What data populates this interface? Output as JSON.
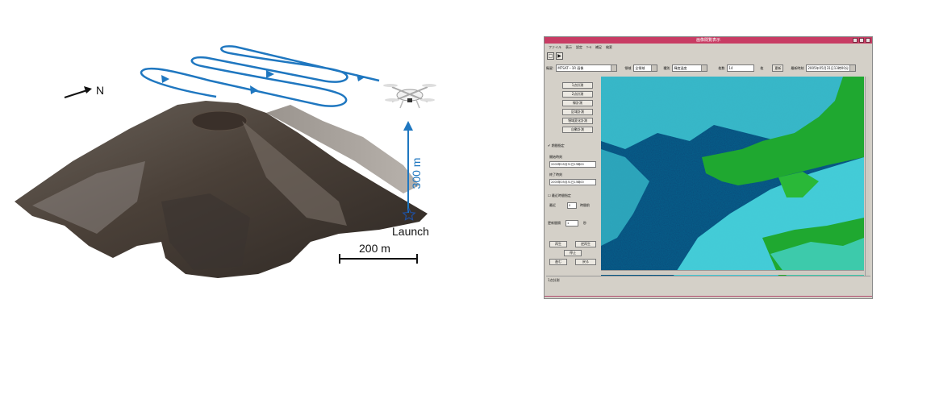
{
  "left_figure": {
    "north_label": "N",
    "altitude_label": "300 m",
    "launch_label": "Launch",
    "scale_label": "200 m",
    "colors": {
      "flight_path": "#1f77c0",
      "terrain_dark": "#4a4038",
      "terrain_light": "#9a948e"
    },
    "icons": [
      "north-arrow-icon",
      "drone-icon",
      "launch-star-icon"
    ]
  },
  "app": {
    "title": "画像閲覧表示",
    "menu": [
      "ファイル",
      "表示",
      "設定",
      "ﾂｰﾙ",
      "補足",
      "検索"
    ],
    "toolbar": [
      "□",
      "▶"
    ],
    "params": {
      "source_label": "衛星:",
      "source_value": "MTSAT－1R 画像",
      "region_label": "領域",
      "region_value": "全領域",
      "type_label": "種別",
      "type_value": "輝度温度",
      "count_label": "枚数",
      "count_value": "14",
      "unit": "枚",
      "update_button": "更新",
      "latest_label": "最新時刻",
      "latest_value": "2005年05月31日13時00分"
    },
    "side_buttons": [
      "1点計測",
      "2点計測",
      "線計測",
      "区域計測",
      "領域変化計測",
      "自動計測"
    ],
    "period_check": "期間指定",
    "start_label": "開始時刻",
    "start_value": "2005年05月31日13時00",
    "end_label": "終了時刻",
    "end_value": "2005年05月31日13時00",
    "recent_check": "最近時間指定",
    "recent_label": "最近",
    "recent_value": "0",
    "recent_unit": "時間前",
    "interval_label": "更新間隔",
    "interval_value": "1",
    "interval_unit": "秒",
    "playback_buttons": [
      "再生",
      "逆再生",
      "停止",
      "進む",
      "戻る"
    ],
    "status": "1点計測",
    "colors": {
      "titlebar": "#c83c64",
      "window_bg": "#d4d0c8",
      "sea_dark": "#0a4a7a",
      "cloud": "#4ad8e0",
      "land": "#1fa830"
    }
  }
}
